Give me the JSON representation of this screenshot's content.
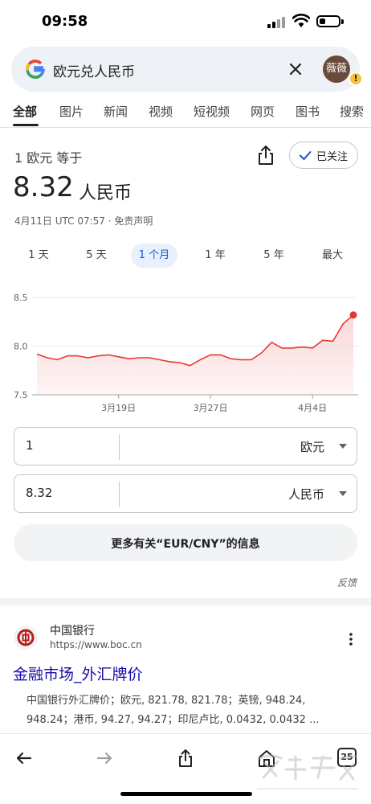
{
  "status_bar": {
    "time": "09:58"
  },
  "search": {
    "query": "欧元兑人民币",
    "avatar_text": "薇薇",
    "alert_text": "!"
  },
  "tabs": [
    {
      "label": "全部",
      "active": true
    },
    {
      "label": "图片"
    },
    {
      "label": "新闻"
    },
    {
      "label": "视频"
    },
    {
      "label": "短视频"
    },
    {
      "label": "网页"
    },
    {
      "label": "图书"
    },
    {
      "label": "搜索"
    }
  ],
  "currency": {
    "rate_label": "1 欧元 等于",
    "follow_label": "已关注",
    "value": "8.32",
    "unit": "人民币",
    "date_text": "4月11日 UTC 07:57 · 免责声明"
  },
  "ranges": [
    {
      "label": "1 天"
    },
    {
      "label": "5 天"
    },
    {
      "label": "1 个月",
      "active": true
    },
    {
      "label": "1 年"
    },
    {
      "label": "5 年"
    },
    {
      "label": "最大"
    }
  ],
  "chart_data": {
    "type": "area",
    "title": "",
    "xlabel": "",
    "ylabel": "",
    "ylim": [
      7.5,
      8.5
    ],
    "yticks": [
      "8.5",
      "8.0",
      "7.5"
    ],
    "xticks": [
      {
        "index": 8,
        "label": "3月19日"
      },
      {
        "index": 17,
        "label": "3月27日"
      },
      {
        "index": 27,
        "label": "4月4日"
      }
    ],
    "grid": true,
    "color": "#e53935",
    "fill_color": "#f8d7d5",
    "series": [
      {
        "values": [
          7.92,
          7.88,
          7.86,
          7.9,
          7.9,
          7.88,
          7.9,
          7.91,
          7.89,
          7.87,
          7.88,
          7.88,
          7.86,
          7.84,
          7.83,
          7.8,
          7.86,
          7.91,
          7.91,
          7.87,
          7.86,
          7.86,
          7.93,
          8.04,
          7.98,
          7.98,
          7.99,
          7.98,
          8.06,
          8.05,
          8.23,
          8.32
        ]
      }
    ]
  },
  "converter": {
    "from_amount": "1",
    "from_currency": "欧元",
    "to_amount": "8.32",
    "to_currency": "人民币"
  },
  "more_info_label": "更多有关“EUR/CNY”的信息",
  "feedback_label": "反馈",
  "result": {
    "site_name": "中国银行",
    "site_url": "https://www.boc.cn",
    "title": "金融市场_外汇牌价",
    "snippet": "中国银行外汇牌价；欧元, 821.78, 821.78；英镑, 948.24, 948.24；港币, 94.27, 94.27；印尼卢比, 0.0432, 0.0432 ..."
  },
  "bottom_bar": {
    "tab_count": "25"
  },
  "colors": {
    "accent_blue": "#1a56c7",
    "link": "#1a0dab",
    "chart_line": "#e53935",
    "alert": "#f6c142"
  },
  "icons": [
    "google-logo-icon",
    "clear-icon",
    "share-icon",
    "check-icon",
    "chevron-right-icon",
    "boc-logo-icon",
    "more-vert-icon",
    "back-icon",
    "forward-icon",
    "home-icon"
  ]
}
